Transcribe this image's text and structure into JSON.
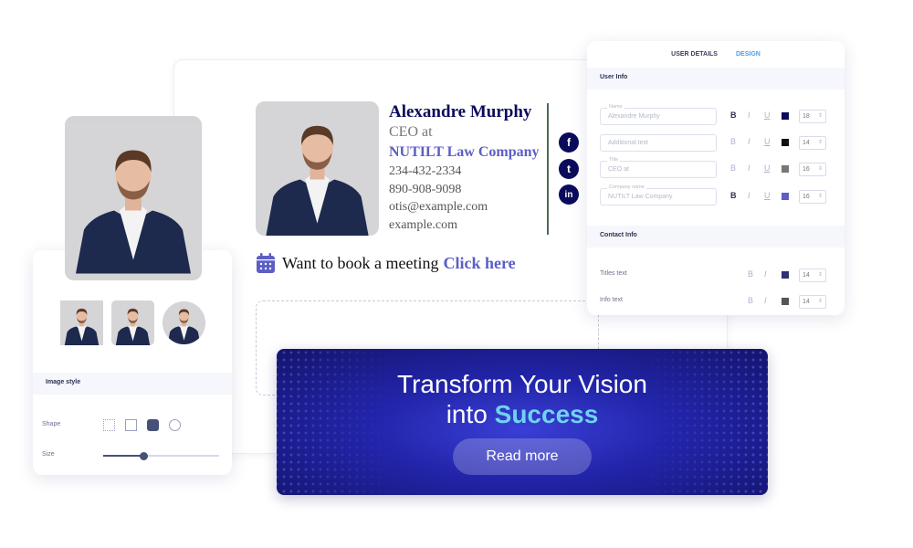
{
  "signature": {
    "name": "Alexandre Murphy",
    "title": "CEO at",
    "company": "NUTILT Law Company",
    "phone1": "234-432-2334",
    "phone2": "890-908-9098",
    "email": "otis@example.com",
    "website": "example.com",
    "social": [
      "f",
      "t",
      "in"
    ],
    "book_text": "Want to book a meeting",
    "book_link": "Click here"
  },
  "design_panel": {
    "tabs": [
      "USER DETAILS",
      "DESIGN"
    ],
    "active_tab": "DESIGN",
    "user_info_heading": "User Info",
    "fields": [
      {
        "label": "Name",
        "value": "Alexandre Murphy",
        "bold": true,
        "color": "#0b0b5c",
        "size": "18"
      },
      {
        "label": "",
        "value": "Additional text",
        "bold": false,
        "color": "#111111",
        "size": "14"
      },
      {
        "label": "Title",
        "value": "CEO at",
        "bold": false,
        "color": "#777777",
        "size": "16"
      },
      {
        "label": "Company name",
        "value": "NUTILT Law Company",
        "bold": true,
        "color": "#5b5ec6",
        "size": "16"
      }
    ],
    "contact_info_heading": "Contact Info",
    "contact_rows": [
      {
        "label": "Titles text",
        "color": "#2d3272",
        "size": "14"
      },
      {
        "label": "Info text",
        "color": "#555555",
        "size": "14"
      }
    ],
    "bold_glyph": "B",
    "italic_glyph": "I",
    "underline_glyph": "U"
  },
  "image_panel": {
    "heading": "Image style",
    "shape_label": "Shape",
    "size_label": "Size",
    "size_value": 0.35,
    "selected_shape": "rounded"
  },
  "banner": {
    "line1": "Transform Your Vision",
    "line2_prefix": "into ",
    "line2_highlight": "Success",
    "button": "Read more"
  }
}
